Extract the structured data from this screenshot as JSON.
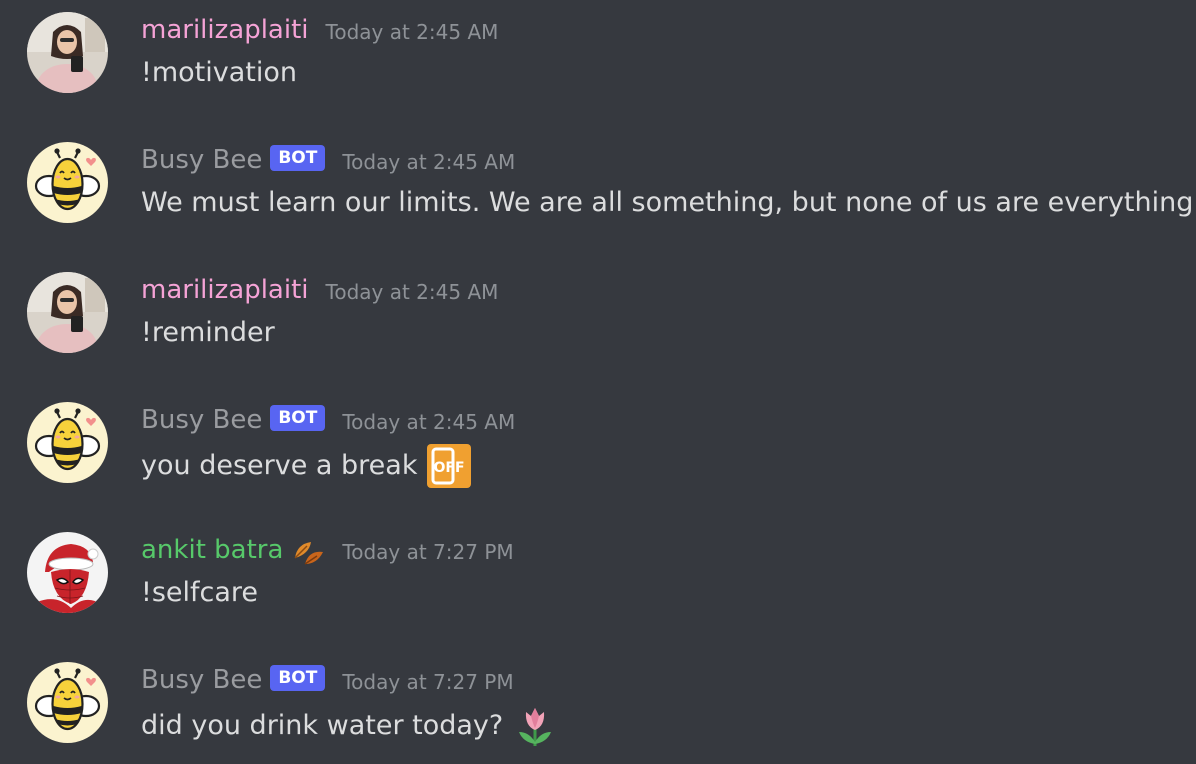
{
  "colors": {
    "background": "#36393f",
    "text": "#dcddde",
    "timestamp": "#8e9297",
    "bot_badge": "#5865f2",
    "user_pink": "#f5a3d6",
    "user_green": "#57c96a",
    "bot_gray": "#9a9ca0"
  },
  "messages": [
    {
      "author": "marilizaplaiti",
      "author_color": "#f5a3d6",
      "avatar": "woman-selfie-avatar",
      "timestamp": "Today at 2:45 AM",
      "text": "!motivation"
    },
    {
      "author": "Busy Bee",
      "author_color": "#9a9ca0",
      "avatar": "bee-avatar",
      "badge": "BOT",
      "timestamp": "Today at 2:45 AM",
      "text": "We must learn our limits. We are all something, but none of us are everything."
    },
    {
      "author": "marilizaplaiti",
      "author_color": "#f5a3d6",
      "avatar": "woman-selfie-avatar",
      "timestamp": "Today at 2:45 AM",
      "text": "!reminder"
    },
    {
      "author": "Busy Bee",
      "author_color": "#9a9ca0",
      "avatar": "bee-avatar",
      "badge": "BOT",
      "timestamp": "Today at 2:45 AM",
      "text": "you deserve a break",
      "emoji": "phone-off-icon",
      "emoji_label": "OFF"
    },
    {
      "author": "ankit batra",
      "author_color": "#57c96a",
      "avatar": "spiderman-santa-avatar",
      "author_emoji": "falling-leaf-icon",
      "timestamp": "Today at 7:27 PM",
      "text": "!selfcare"
    },
    {
      "author": "Busy Bee",
      "author_color": "#9a9ca0",
      "avatar": "bee-avatar",
      "badge": "BOT",
      "timestamp": "Today at 7:27 PM",
      "text": "did you drink water today?",
      "emoji": "tulip-icon"
    }
  ]
}
